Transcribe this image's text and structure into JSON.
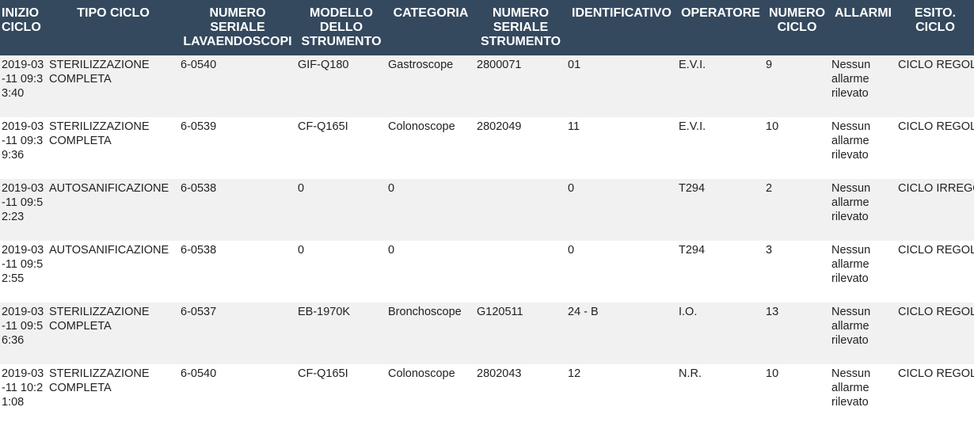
{
  "table": {
    "headers": {
      "inizio": "INIZIO CICLO",
      "tipo": "TIPO CICLO",
      "seriale_lav": "NUMERO SERIALE LAVAENDOSCOPI",
      "modello": "MODELLO DELLO STRUMENTO",
      "categoria": "CATEGORIA",
      "seriale_str": "NUMERO SERIALE STRUMENTO",
      "identificativo": "IDENTIFICATIVO",
      "operatore": "OPERATORE",
      "numero_ciclo": "NUMERO CICLO",
      "allarmi": "ALLARMI",
      "esito": "ESITO. CICLO"
    },
    "rows": [
      {
        "inizio": "2019-03-11 09:33:40",
        "tipo": "STERILIZZAZIONE COMPLETA",
        "seriale_lav": "6-0540",
        "modello": "GIF-Q180",
        "categoria": "Gastroscope",
        "seriale_str": "2800071",
        "identificativo": "01",
        "operatore": "E.V.I.",
        "numero_ciclo": "9",
        "allarmi": "Nessun allarme rilevato",
        "esito": "CICLO REGOLARE"
      },
      {
        "inizio": "2019-03-11 09:39:36",
        "tipo": "STERILIZZAZIONE COMPLETA",
        "seriale_lav": "6-0539",
        "modello": "CF-Q165I",
        "categoria": "Colonoscope",
        "seriale_str": "2802049",
        "identificativo": "11",
        "operatore": "E.V.I.",
        "numero_ciclo": "10",
        "allarmi": "Nessun allarme rilevato",
        "esito": "CICLO REGOLARE"
      },
      {
        "inizio": "2019-03-11 09:52:23",
        "tipo": "AUTOSANIFICAZIONE",
        "seriale_lav": "6-0538",
        "modello": "0",
        "categoria": "0",
        "seriale_str": "",
        "identificativo": "0",
        "operatore": "T294",
        "numero_ciclo": "2",
        "allarmi": "Nessun allarme rilevato",
        "esito": "CICLO IRREGOLARE"
      },
      {
        "inizio": "2019-03-11 09:52:55",
        "tipo": "AUTOSANIFICAZIONE",
        "seriale_lav": "6-0538",
        "modello": "0",
        "categoria": "0",
        "seriale_str": "",
        "identificativo": "0",
        "operatore": "T294",
        "numero_ciclo": "3",
        "allarmi": "Nessun allarme rilevato",
        "esito": "CICLO REGOLARE"
      },
      {
        "inizio": "2019-03-11 09:56:36",
        "tipo": "STERILIZZAZIONE COMPLETA",
        "seriale_lav": "6-0537",
        "modello": "EB-1970K",
        "categoria": "Bronchoscope",
        "seriale_str": "G120511",
        "identificativo": "24 - B",
        "operatore": "I.O.",
        "numero_ciclo": "13",
        "allarmi": "Nessun allarme rilevato",
        "esito": "CICLO REGOLARE"
      },
      {
        "inizio": "2019-03-11 10:21:08",
        "tipo": "STERILIZZAZIONE COMPLETA",
        "seriale_lav": "6-0540",
        "modello": "CF-Q165I",
        "categoria": "Colonoscope",
        "seriale_str": "2802043",
        "identificativo": "12",
        "operatore": "N.R.",
        "numero_ciclo": "10",
        "allarmi": "Nessun allarme rilevato",
        "esito": "CICLO REGOLARE"
      }
    ]
  }
}
